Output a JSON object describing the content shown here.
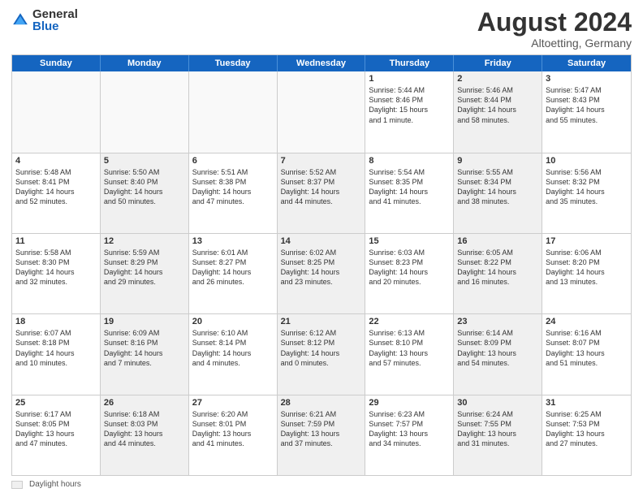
{
  "logo": {
    "general": "General",
    "blue": "Blue"
  },
  "header": {
    "month_year": "August 2024",
    "location": "Altoetting, Germany"
  },
  "days_of_week": [
    "Sunday",
    "Monday",
    "Tuesday",
    "Wednesday",
    "Thursday",
    "Friday",
    "Saturday"
  ],
  "footer": {
    "legend_label": "Daylight hours"
  },
  "weeks": [
    [
      {
        "day": "",
        "text": "",
        "empty": true
      },
      {
        "day": "",
        "text": "",
        "empty": true
      },
      {
        "day": "",
        "text": "",
        "empty": true
      },
      {
        "day": "",
        "text": "",
        "empty": true
      },
      {
        "day": "1",
        "text": "Sunrise: 5:44 AM\nSunset: 8:46 PM\nDaylight: 15 hours\nand 1 minute.",
        "empty": false,
        "shaded": false
      },
      {
        "day": "2",
        "text": "Sunrise: 5:46 AM\nSunset: 8:44 PM\nDaylight: 14 hours\nand 58 minutes.",
        "empty": false,
        "shaded": true
      },
      {
        "day": "3",
        "text": "Sunrise: 5:47 AM\nSunset: 8:43 PM\nDaylight: 14 hours\nand 55 minutes.",
        "empty": false,
        "shaded": false
      }
    ],
    [
      {
        "day": "4",
        "text": "Sunrise: 5:48 AM\nSunset: 8:41 PM\nDaylight: 14 hours\nand 52 minutes.",
        "empty": false,
        "shaded": false
      },
      {
        "day": "5",
        "text": "Sunrise: 5:50 AM\nSunset: 8:40 PM\nDaylight: 14 hours\nand 50 minutes.",
        "empty": false,
        "shaded": true
      },
      {
        "day": "6",
        "text": "Sunrise: 5:51 AM\nSunset: 8:38 PM\nDaylight: 14 hours\nand 47 minutes.",
        "empty": false,
        "shaded": false
      },
      {
        "day": "7",
        "text": "Sunrise: 5:52 AM\nSunset: 8:37 PM\nDaylight: 14 hours\nand 44 minutes.",
        "empty": false,
        "shaded": true
      },
      {
        "day": "8",
        "text": "Sunrise: 5:54 AM\nSunset: 8:35 PM\nDaylight: 14 hours\nand 41 minutes.",
        "empty": false,
        "shaded": false
      },
      {
        "day": "9",
        "text": "Sunrise: 5:55 AM\nSunset: 8:34 PM\nDaylight: 14 hours\nand 38 minutes.",
        "empty": false,
        "shaded": true
      },
      {
        "day": "10",
        "text": "Sunrise: 5:56 AM\nSunset: 8:32 PM\nDaylight: 14 hours\nand 35 minutes.",
        "empty": false,
        "shaded": false
      }
    ],
    [
      {
        "day": "11",
        "text": "Sunrise: 5:58 AM\nSunset: 8:30 PM\nDaylight: 14 hours\nand 32 minutes.",
        "empty": false,
        "shaded": false
      },
      {
        "day": "12",
        "text": "Sunrise: 5:59 AM\nSunset: 8:29 PM\nDaylight: 14 hours\nand 29 minutes.",
        "empty": false,
        "shaded": true
      },
      {
        "day": "13",
        "text": "Sunrise: 6:01 AM\nSunset: 8:27 PM\nDaylight: 14 hours\nand 26 minutes.",
        "empty": false,
        "shaded": false
      },
      {
        "day": "14",
        "text": "Sunrise: 6:02 AM\nSunset: 8:25 PM\nDaylight: 14 hours\nand 23 minutes.",
        "empty": false,
        "shaded": true
      },
      {
        "day": "15",
        "text": "Sunrise: 6:03 AM\nSunset: 8:23 PM\nDaylight: 14 hours\nand 20 minutes.",
        "empty": false,
        "shaded": false
      },
      {
        "day": "16",
        "text": "Sunrise: 6:05 AM\nSunset: 8:22 PM\nDaylight: 14 hours\nand 16 minutes.",
        "empty": false,
        "shaded": true
      },
      {
        "day": "17",
        "text": "Sunrise: 6:06 AM\nSunset: 8:20 PM\nDaylight: 14 hours\nand 13 minutes.",
        "empty": false,
        "shaded": false
      }
    ],
    [
      {
        "day": "18",
        "text": "Sunrise: 6:07 AM\nSunset: 8:18 PM\nDaylight: 14 hours\nand 10 minutes.",
        "empty": false,
        "shaded": false
      },
      {
        "day": "19",
        "text": "Sunrise: 6:09 AM\nSunset: 8:16 PM\nDaylight: 14 hours\nand 7 minutes.",
        "empty": false,
        "shaded": true
      },
      {
        "day": "20",
        "text": "Sunrise: 6:10 AM\nSunset: 8:14 PM\nDaylight: 14 hours\nand 4 minutes.",
        "empty": false,
        "shaded": false
      },
      {
        "day": "21",
        "text": "Sunrise: 6:12 AM\nSunset: 8:12 PM\nDaylight: 14 hours\nand 0 minutes.",
        "empty": false,
        "shaded": true
      },
      {
        "day": "22",
        "text": "Sunrise: 6:13 AM\nSunset: 8:10 PM\nDaylight: 13 hours\nand 57 minutes.",
        "empty": false,
        "shaded": false
      },
      {
        "day": "23",
        "text": "Sunrise: 6:14 AM\nSunset: 8:09 PM\nDaylight: 13 hours\nand 54 minutes.",
        "empty": false,
        "shaded": true
      },
      {
        "day": "24",
        "text": "Sunrise: 6:16 AM\nSunset: 8:07 PM\nDaylight: 13 hours\nand 51 minutes.",
        "empty": false,
        "shaded": false
      }
    ],
    [
      {
        "day": "25",
        "text": "Sunrise: 6:17 AM\nSunset: 8:05 PM\nDaylight: 13 hours\nand 47 minutes.",
        "empty": false,
        "shaded": false
      },
      {
        "day": "26",
        "text": "Sunrise: 6:18 AM\nSunset: 8:03 PM\nDaylight: 13 hours\nand 44 minutes.",
        "empty": false,
        "shaded": true
      },
      {
        "day": "27",
        "text": "Sunrise: 6:20 AM\nSunset: 8:01 PM\nDaylight: 13 hours\nand 41 minutes.",
        "empty": false,
        "shaded": false
      },
      {
        "day": "28",
        "text": "Sunrise: 6:21 AM\nSunset: 7:59 PM\nDaylight: 13 hours\nand 37 minutes.",
        "empty": false,
        "shaded": true
      },
      {
        "day": "29",
        "text": "Sunrise: 6:23 AM\nSunset: 7:57 PM\nDaylight: 13 hours\nand 34 minutes.",
        "empty": false,
        "shaded": false
      },
      {
        "day": "30",
        "text": "Sunrise: 6:24 AM\nSunset: 7:55 PM\nDaylight: 13 hours\nand 31 minutes.",
        "empty": false,
        "shaded": true
      },
      {
        "day": "31",
        "text": "Sunrise: 6:25 AM\nSunset: 7:53 PM\nDaylight: 13 hours\nand 27 minutes.",
        "empty": false,
        "shaded": false
      }
    ]
  ]
}
